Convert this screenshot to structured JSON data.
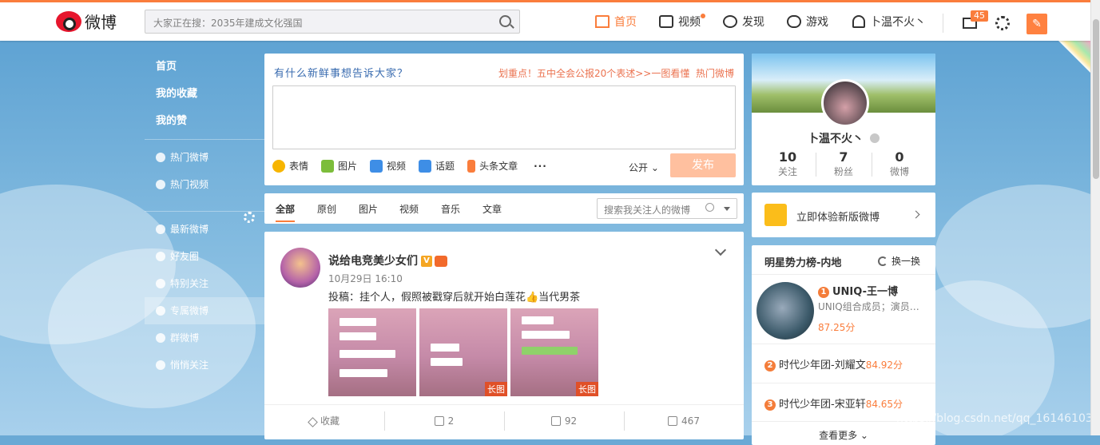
{
  "header": {
    "logo_text": "微博",
    "search_placeholder": "大家正在搜：2035年建成文化强国",
    "nav": [
      {
        "label": "首页",
        "icon": "home-icon",
        "active": true
      },
      {
        "label": "视频",
        "icon": "video-icon"
      },
      {
        "label": "发现",
        "icon": "compass-icon"
      },
      {
        "label": "游戏",
        "icon": "gamepad-icon"
      },
      {
        "label": "卜温不火丶",
        "icon": "user-icon"
      }
    ],
    "mail_count": "45"
  },
  "sidebar": {
    "top": [
      "首页",
      "我的收藏",
      "我的赞"
    ],
    "mid": [
      "热门微博",
      "热门视频"
    ],
    "groups": [
      "最新微博",
      "好友圈",
      "特别关注",
      "专属微博",
      "群微博",
      "悄悄关注"
    ]
  },
  "publisher": {
    "prompt": "有什么新鲜事想告诉大家？",
    "hint": "划重点！五中全会公报20个表述>>一图看懂",
    "hot": "热门微博",
    "tools": [
      "表情",
      "图片",
      "视频",
      "话题",
      "头条文章"
    ],
    "visibility": "公开",
    "submit": "发布"
  },
  "tabs": {
    "items": [
      "全部",
      "原创",
      "图片",
      "视频",
      "音乐",
      "文章"
    ],
    "search_placeholder": "搜索我关注人的微博"
  },
  "post": {
    "author": "说给电竞美少女们",
    "time": "10月29日 16:10",
    "text": "投稿：挂个人，假照被戳穿后就开始白莲花👍当代男茶",
    "image_tag": "长图",
    "actions": {
      "fav": "收藏",
      "repost": "2",
      "comment": "92",
      "like": "467"
    }
  },
  "profile": {
    "name": "卜温不火丶",
    "following": "10",
    "following_label": "关注",
    "fans": "7",
    "fans_label": "粉丝",
    "weibo": "0",
    "weibo_label": "微博"
  },
  "newversion": {
    "label": "立即体验新版微博"
  },
  "stars": {
    "title": "明星势力榜-内地",
    "refresh": "换一换",
    "first": {
      "rank": "1",
      "name": "UNIQ-王一博",
      "desc": "UNIQ组合成员；演员…",
      "score": "87.25分"
    },
    "rows": [
      {
        "rank": "2",
        "name": "时代少年团-刘耀文",
        "score": "84.92分"
      },
      {
        "rank": "3",
        "name": "时代少年团-宋亚轩",
        "score": "84.65分"
      }
    ],
    "more": "查看更多 ⌄"
  },
  "watermark": "https://blog.csdn.net/qq_16146103"
}
